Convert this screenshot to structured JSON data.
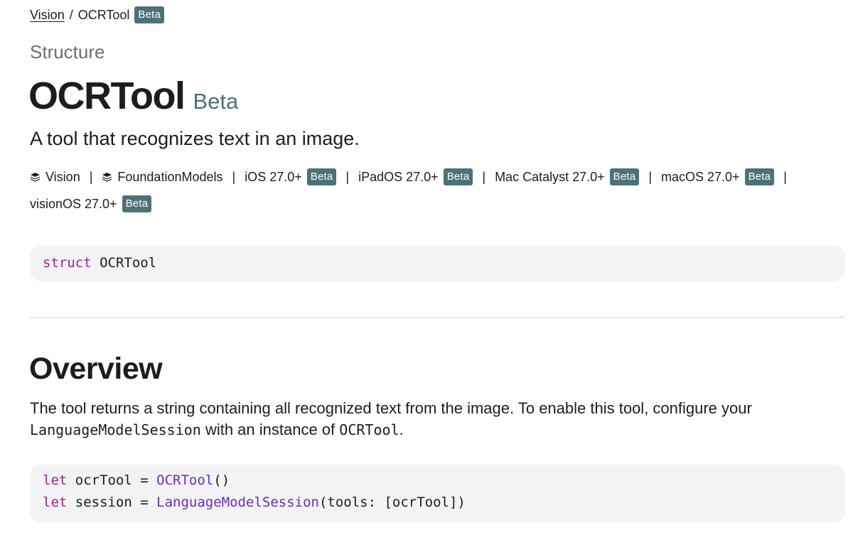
{
  "breadcrumb": {
    "parent": "Vision",
    "separator": "/",
    "current": "OCRTool",
    "badge": "Beta"
  },
  "header": {
    "eyebrow": "Structure",
    "title": "OCRTool",
    "title_badge": "Beta",
    "abstract": "A tool that recognizes text in an image."
  },
  "availability": {
    "frameworks": [
      "Vision",
      "FoundationModels"
    ],
    "platforms": [
      {
        "name": "iOS 27.0+",
        "badge": "Beta"
      },
      {
        "name": "iPadOS 27.0+",
        "badge": "Beta"
      },
      {
        "name": "Mac Catalyst 27.0+",
        "badge": "Beta"
      },
      {
        "name": "macOS 27.0+",
        "badge": "Beta"
      },
      {
        "name": "visionOS 27.0+",
        "badge": "Beta"
      }
    ],
    "separator": "|",
    "framework_icon": "stack-icon"
  },
  "declaration": {
    "keyword": "struct",
    "name": "OCRTool"
  },
  "overview": {
    "title": "Overview",
    "text_part1": "The tool returns a string containing all recognized text from the image. To enable this tool, configure your ",
    "code1": "LanguageModelSession",
    "text_part2": " with an instance of ",
    "code2": "OCRTool",
    "text_part3": "."
  },
  "code_example": {
    "line1": {
      "kw": "let",
      "rest1": " ocrTool = ",
      "type": "OCRTool",
      "rest2": "()"
    },
    "line2": {
      "kw": "let",
      "rest1": " session = ",
      "type": "LanguageModelSession",
      "rest2": "(tools: [ocrTool])"
    }
  },
  "colors": {
    "badge": "#4d7178",
    "keyword": "#9b2393",
    "type": "#6a2fb3",
    "code_background": "#f3f3f5"
  }
}
